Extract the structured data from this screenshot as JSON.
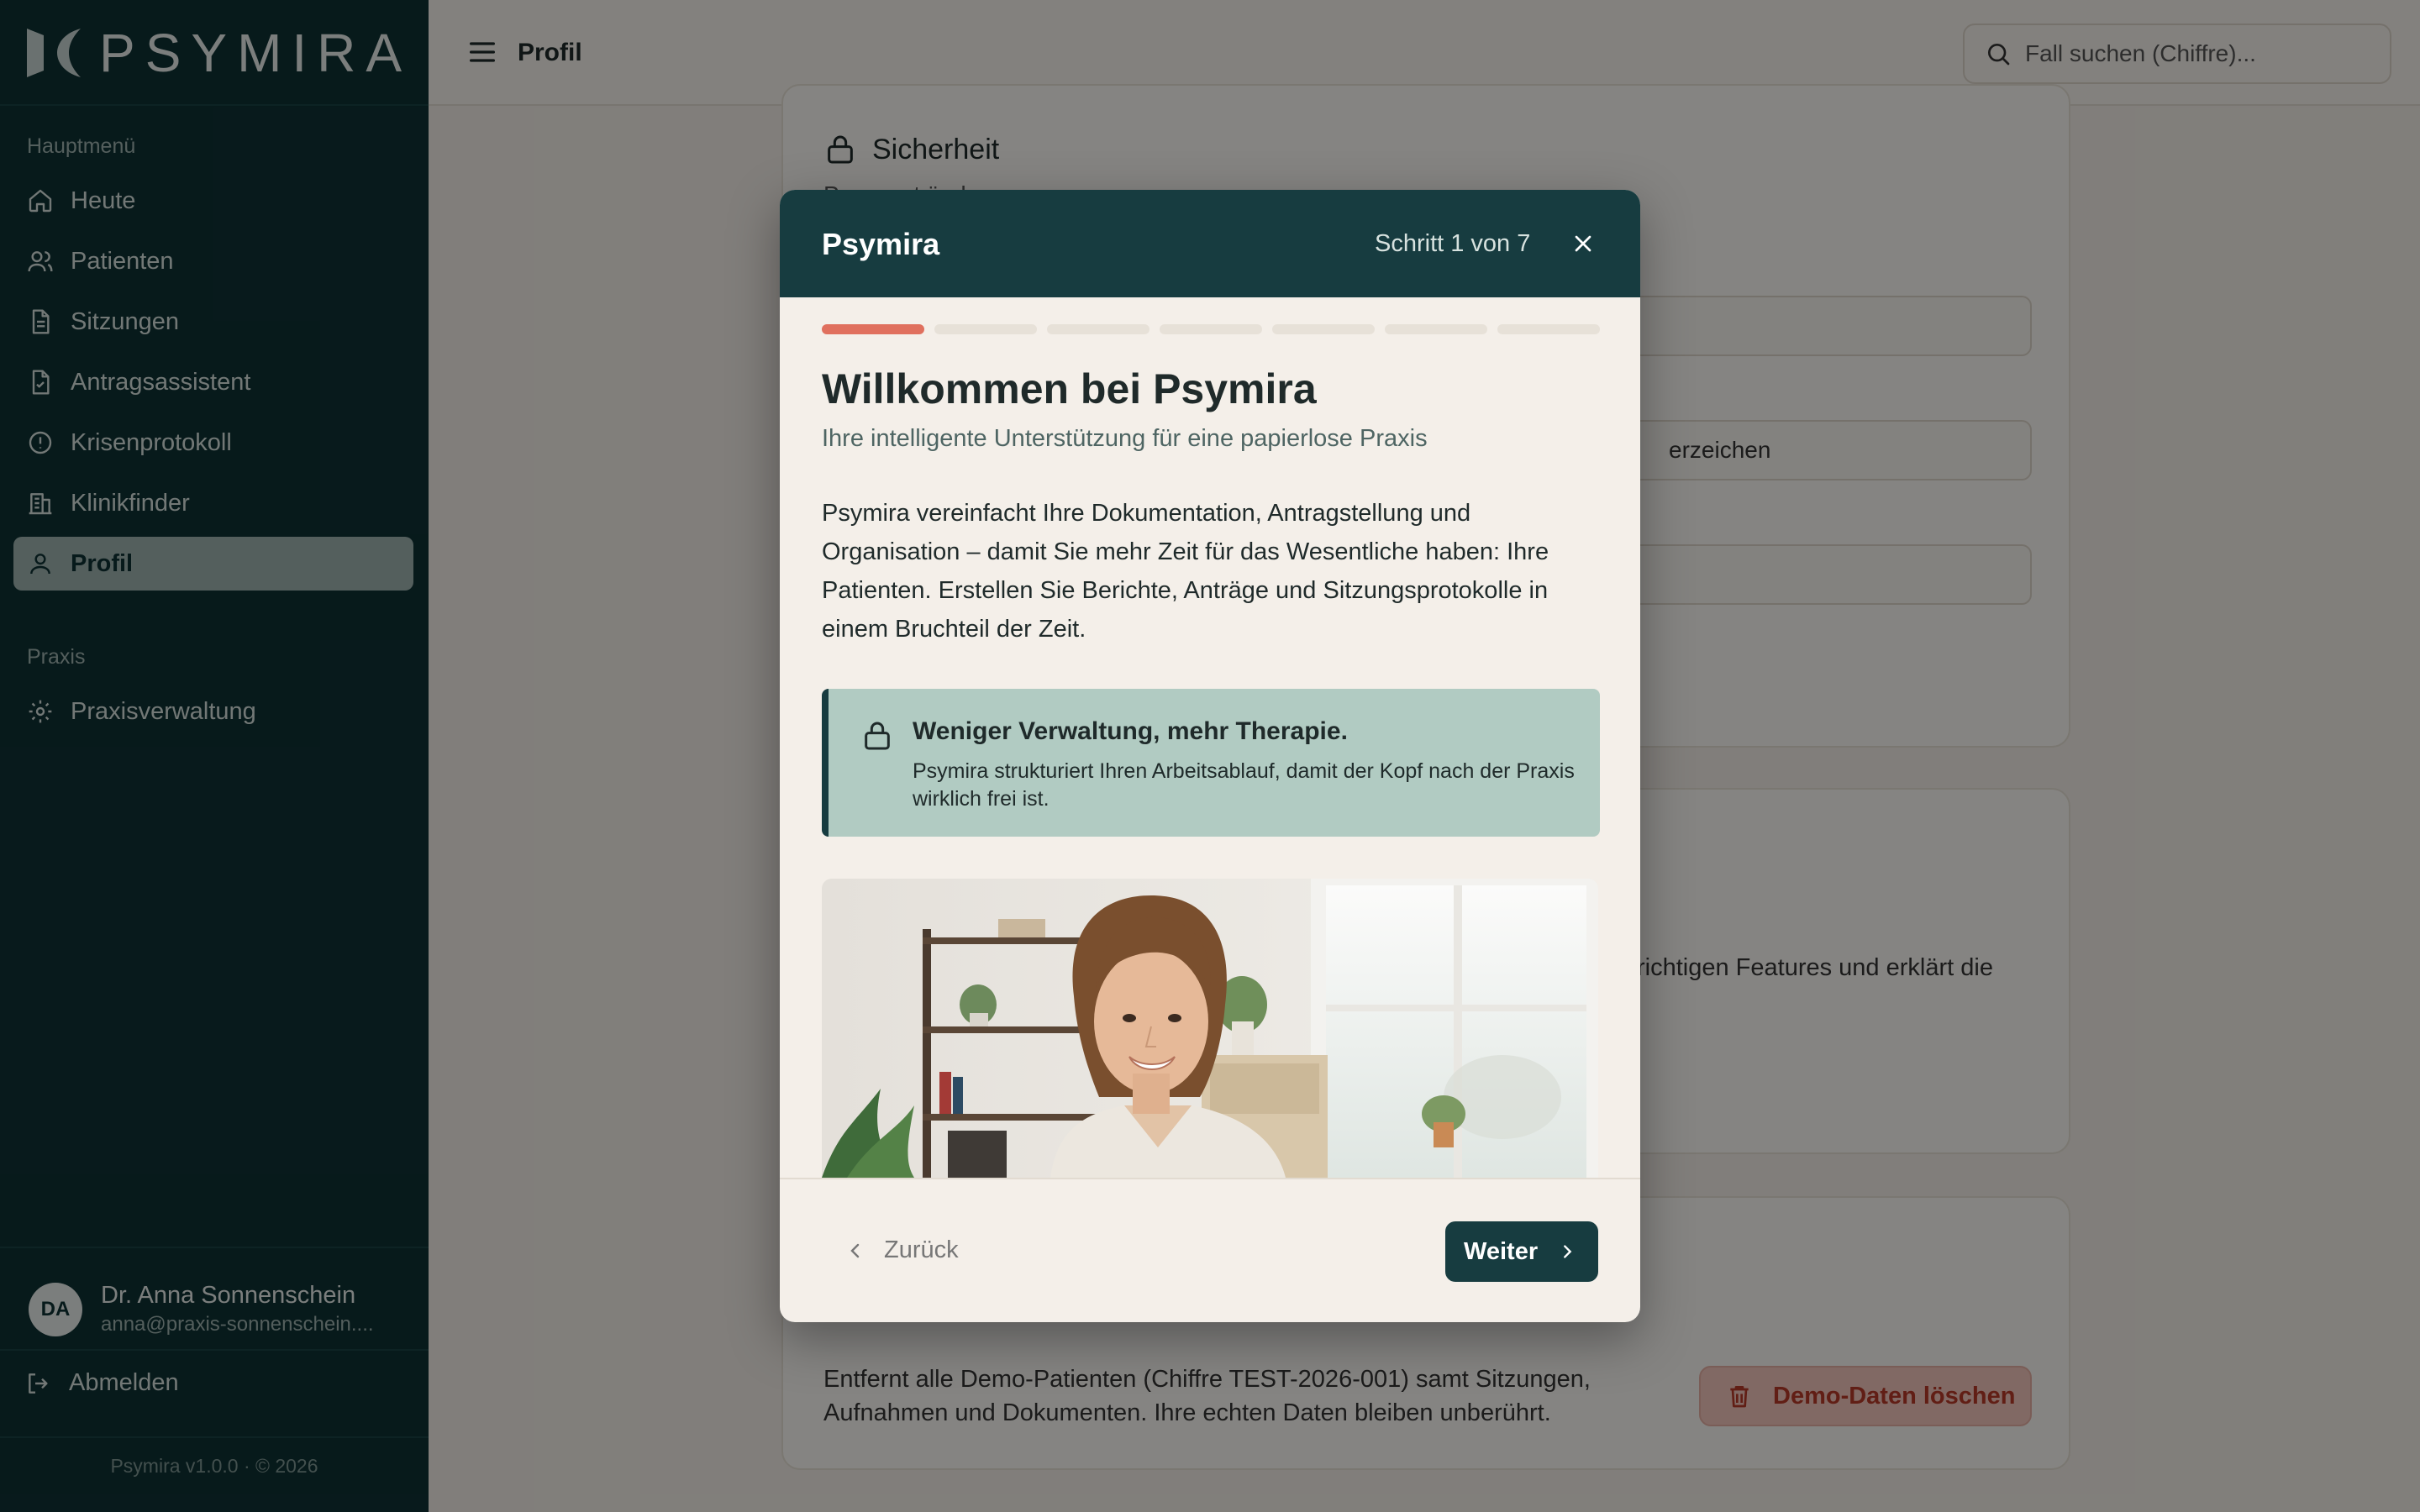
{
  "brand": {
    "name": "PSYMIRA"
  },
  "sidebar": {
    "main_section_label": "Hauptmenü",
    "items": [
      {
        "label": "Heute",
        "icon": "home-icon"
      },
      {
        "label": "Patienten",
        "icon": "users-icon"
      },
      {
        "label": "Sitzungen",
        "icon": "document-icon"
      },
      {
        "label": "Antragsassistent",
        "icon": "file-check-icon"
      },
      {
        "label": "Krisenprotokoll",
        "icon": "alert-circle-icon"
      },
      {
        "label": "Klinikfinder",
        "icon": "building-icon"
      },
      {
        "label": "Profil",
        "icon": "user-icon",
        "active": true
      }
    ],
    "practice_section_label": "Praxis",
    "practice_items": [
      {
        "label": "Praxisverwaltung",
        "icon": "gear-icon"
      }
    ],
    "user": {
      "initials": "DA",
      "name": "Dr. Anna Sonnenschein",
      "email": "anna@praxis-sonnenschein...."
    },
    "logout_label": "Abmelden",
    "version": "Psymira v1.0.0 · © 2026"
  },
  "topbar": {
    "title": "Profil",
    "search_placeholder": "Fall suchen (Chiffre)..."
  },
  "main": {
    "security": {
      "title": "Sicherheit",
      "subtitle": "Passwort ändern",
      "field_2_visible": "erzeichen"
    },
    "tour": {
      "visible_text": "richtigen Features und erklärt die"
    },
    "demo": {
      "description": "Entfernt alle Demo-Patienten (Chiffre TEST-2026-001) samt Sitzungen, Aufnahmen und Dokumenten. Ihre echten Daten bleiben unberührt.",
      "button_label": "Demo-Daten löschen"
    }
  },
  "modal": {
    "title": "Psymira",
    "step": "Schritt 1 von 7",
    "progress": {
      "current": 1,
      "total": 7
    },
    "heading": "Willkommen bei Psymira",
    "subheading": "Ihre intelligente Unterstützung für eine papierlose Praxis",
    "body": "Psymira vereinfacht Ihre Dokumentation, Antragstellung und Organisation – damit Sie mehr Zeit für das Wesentliche haben: Ihre Patienten. Erstellen Sie Berichte, Anträge und Sitzungsprotokolle in einem Bruchteil der Zeit.",
    "callout": {
      "title": "Weniger Verwaltung, mehr Therapie.",
      "text": "Psymira strukturiert Ihren Arbeitsablauf, damit der Kopf nach der Praxis wirklich frei ist."
    },
    "back_label": "Zurück",
    "next_label": "Weiter"
  },
  "colors": {
    "sidebar_bg": "#0f3134",
    "modal_header": "#173c40",
    "accent_progress": "#e0705e",
    "callout_bg": "#b1cbc2",
    "danger": "#b83a28"
  }
}
